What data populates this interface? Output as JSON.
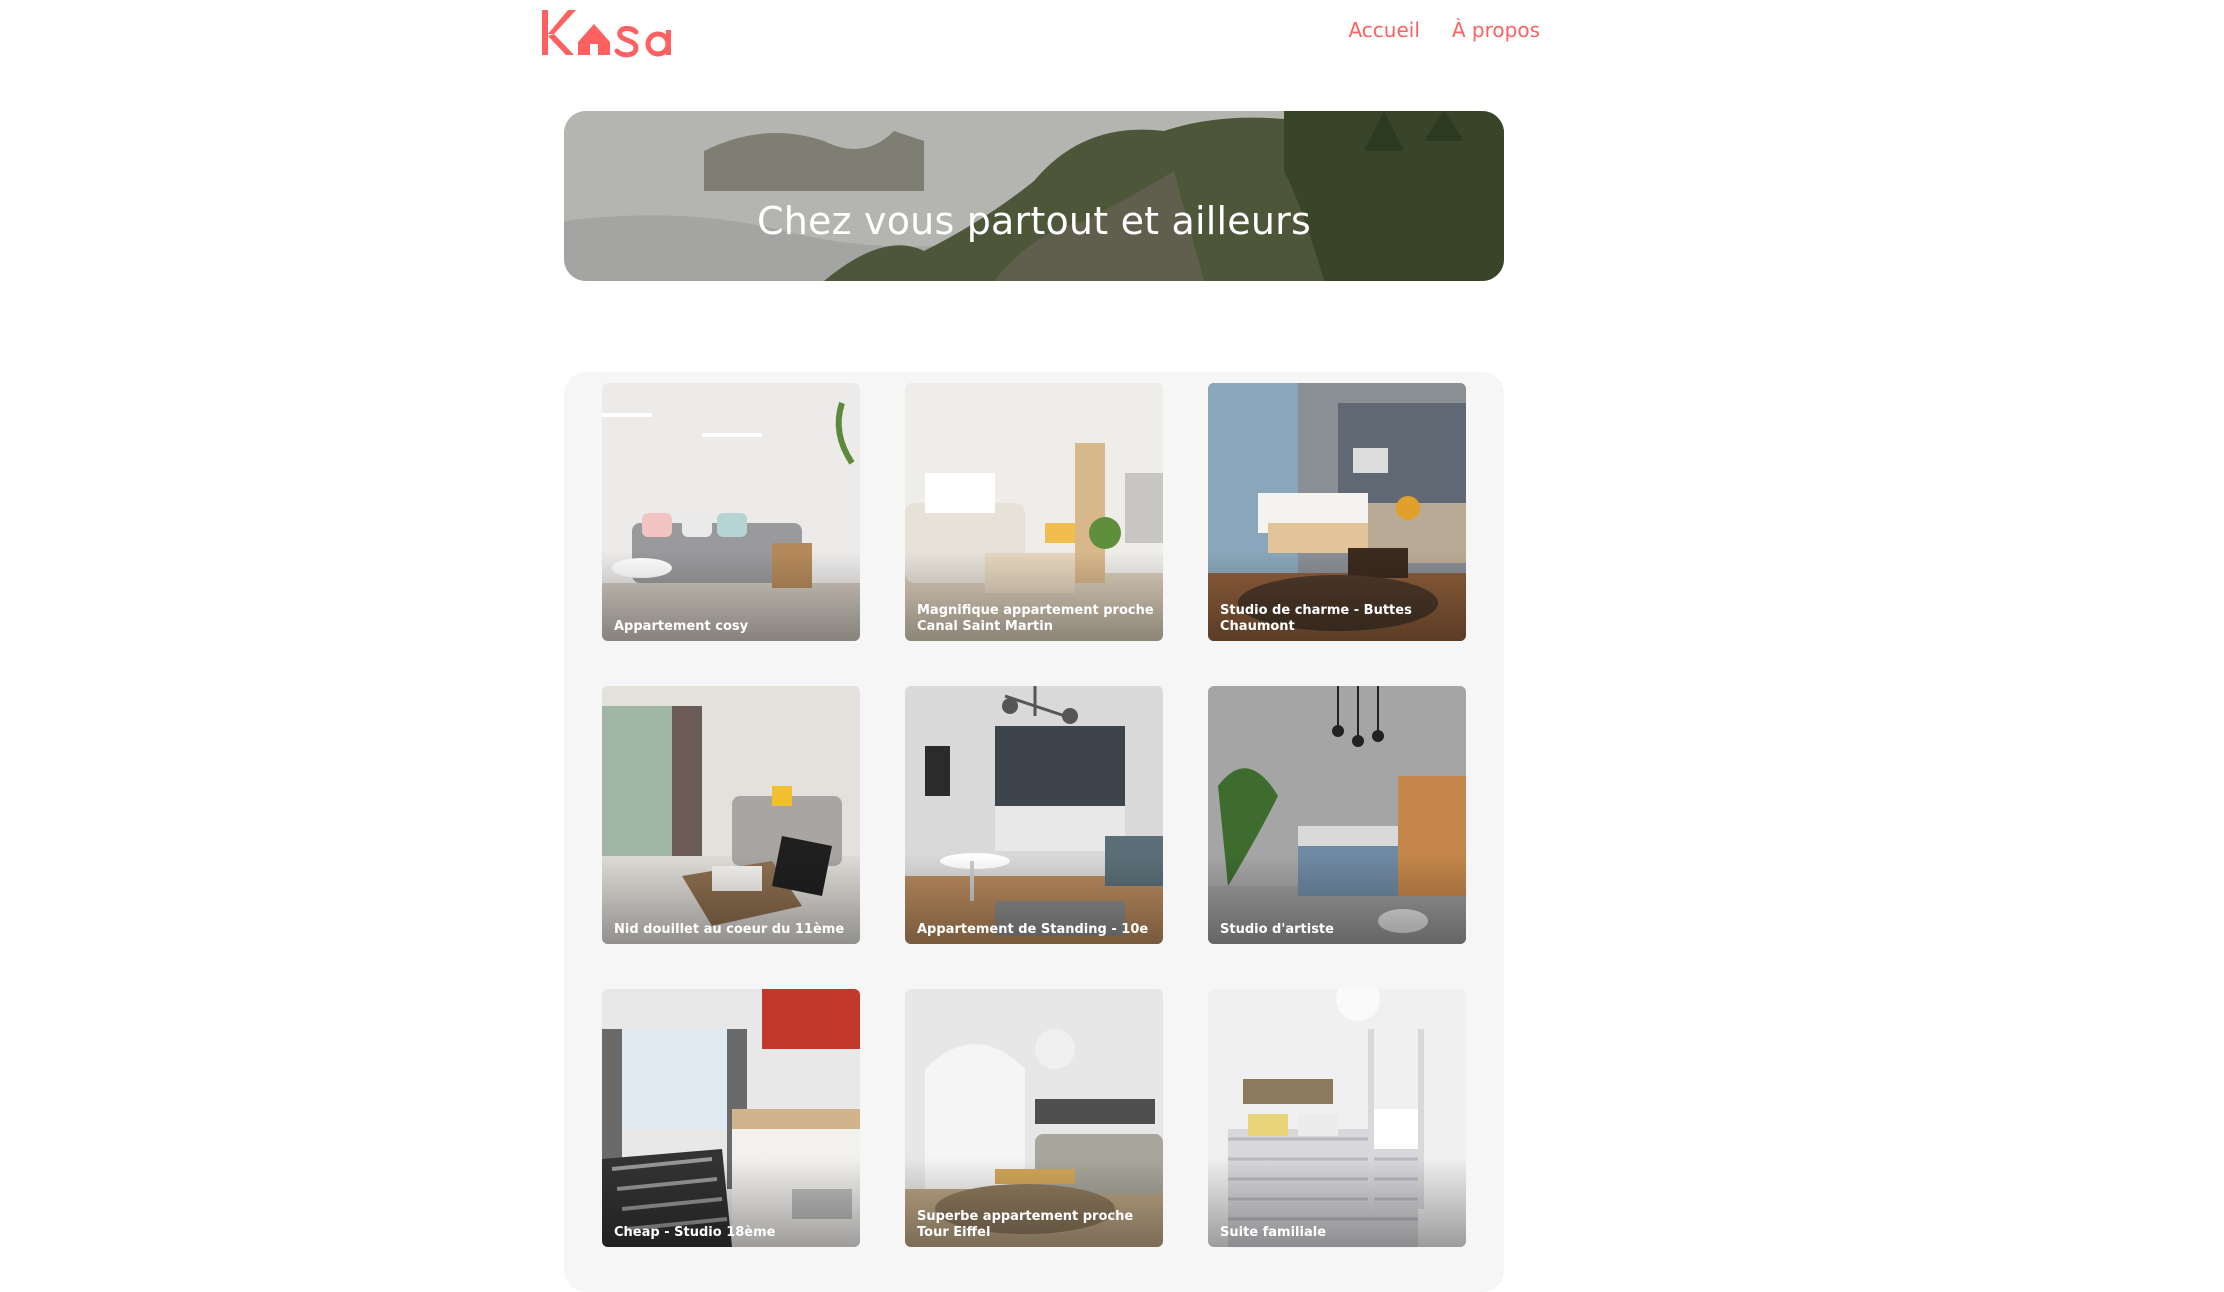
{
  "brand": {
    "logo_text": "Kasa",
    "accent": "#FF6060"
  },
  "nav": {
    "items": [
      "Accueil",
      "À propos"
    ]
  },
  "banner": {
    "title": "Chez vous partout et ailleurs"
  },
  "listings": [
    {
      "title": "Appartement cosy"
    },
    {
      "title": "Magnifique appartement proche Canal Saint Martin"
    },
    {
      "title": "Studio de charme - Buttes Chaumont"
    },
    {
      "title": "Nid douillet au coeur du 11ème"
    },
    {
      "title": "Appartement de Standing - 10e"
    },
    {
      "title": "Studio d'artiste"
    },
    {
      "title": "Cheap - Studio 18ème"
    },
    {
      "title": "Superbe appartement proche Tour Eiffel"
    },
    {
      "title": "Suite familiale"
    }
  ]
}
